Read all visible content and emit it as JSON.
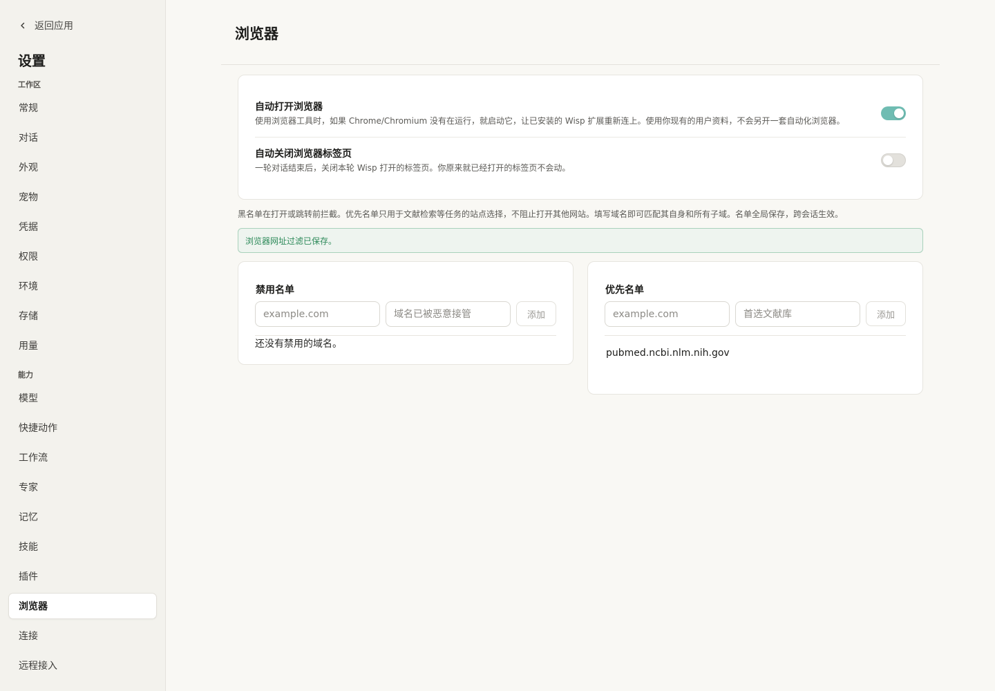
{
  "sidebar": {
    "back_label": "返回应用",
    "title": "设置",
    "sections": [
      {
        "label": "工作区",
        "items": [
          "常规",
          "对话",
          "外观",
          "宠物",
          "凭据",
          "权限",
          "环境",
          "存储",
          "用量"
        ]
      },
      {
        "label": "能力",
        "items": [
          "模型",
          "快捷动作",
          "工作流",
          "专家",
          "记忆",
          "技能",
          "插件",
          "浏览器",
          "连接",
          "远程接入"
        ]
      }
    ],
    "active_item": "浏览器"
  },
  "page": {
    "title": "浏览器"
  },
  "settings": {
    "auto_open": {
      "title": "自动打开浏览器",
      "description": "使用浏览器工具时，如果 Chrome/Chromium 没有在运行，就启动它，让已安装的 Wisp 扩展重新连上。使用你现有的用户资料，不会另开一套自动化浏览器。",
      "enabled": true
    },
    "auto_close": {
      "title": "自动关闭浏览器标签页",
      "description": "一轮对话结束后，关闭本轮 Wisp 打开的标签页。你原来就已经打开的标签页不会动。",
      "enabled": false
    }
  },
  "filter_note": "黑名单在打开或跳转前拦截。优先名单只用于文献检索等任务的站点选择，不阻止打开其他网站。填写域名即可匹配其自身和所有子域。名单全局保存，跨会话生效。",
  "banner_text": "浏览器网址过滤已保存。",
  "blocklist": {
    "title": "禁用名单",
    "domain_placeholder": "example.com",
    "reason_placeholder": "域名已被恶意接管",
    "add_label": "添加",
    "empty_text": "还没有禁用的域名。",
    "items": []
  },
  "preferred": {
    "title": "优先名单",
    "domain_placeholder": "example.com",
    "reason_placeholder": "首选文献库",
    "add_label": "添加",
    "items": [
      "pubmed.ncbi.nlm.nih.gov"
    ]
  },
  "colors": {
    "accent_toggle": "#6fbcb2",
    "success_text": "#2e8a5a",
    "success_bg": "#eef4ef",
    "background": "#f9f8f4",
    "sidebar_bg": "#f3f2ed"
  }
}
